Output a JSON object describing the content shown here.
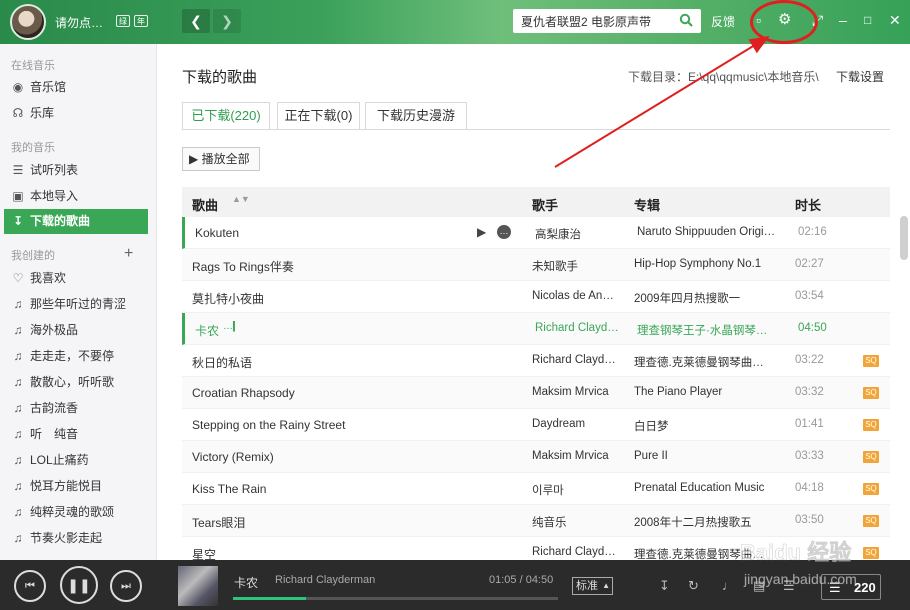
{
  "header": {
    "user_name": "请勿点…",
    "badge1": "绿",
    "badge2": "年",
    "search_placeholder": "夏仇者联盟2 电影原声带",
    "search_value": "夏仇者联盟2 电影原声带",
    "feedback_label": "反馈",
    "icons": [
      "back-arrow-icon",
      "forward-arrow-icon",
      "search-icon",
      "shirt-icon",
      "gear-icon",
      "resize-icon",
      "minimize-icon",
      "maximize-icon",
      "close-icon"
    ]
  },
  "sidebar": {
    "sections": [
      {
        "title": "在线音乐"
      },
      {
        "title": "我的音乐"
      },
      {
        "title": "我创建的"
      }
    ],
    "online": [
      {
        "label": "音乐馆",
        "icon": "music-hall-icon"
      },
      {
        "label": "乐库",
        "icon": "headphones-icon"
      }
    ],
    "mine": [
      {
        "label": "试听列表",
        "icon": "list-icon"
      },
      {
        "label": "本地导入",
        "icon": "monitor-icon"
      },
      {
        "label": "下载的歌曲",
        "icon": "download-icon"
      }
    ],
    "created": [
      {
        "label": "我喜欢",
        "icon": "heart-icon"
      },
      {
        "label": "那些年听过的青涩",
        "icon": "music-note-icon"
      },
      {
        "label": "海外极品",
        "icon": "music-note-icon"
      },
      {
        "label": "走走走，不要停",
        "icon": "music-note-icon"
      },
      {
        "label": "散散心，听听歌",
        "icon": "music-note-icon"
      },
      {
        "label": "古韵流香",
        "icon": "music-note-icon"
      },
      {
        "label": "听　纯音",
        "icon": "music-note-icon"
      },
      {
        "label": "LOL止痛药",
        "icon": "music-note-icon"
      },
      {
        "label": "悦耳方能悦目",
        "icon": "music-note-icon"
      },
      {
        "label": "纯粹灵魂的歌颂",
        "icon": "music-note-icon"
      },
      {
        "label": "节奏火影走起",
        "icon": "music-note-icon"
      }
    ]
  },
  "main": {
    "title": "下载的歌曲",
    "download_dir": "下载目录：E:\\qq\\qqmusic\\本地音乐\\",
    "download_settings": "下载设置",
    "tabs": [
      {
        "label": "已下载(220)"
      },
      {
        "label": "正在下载(0)"
      },
      {
        "label": "下载历史漫游"
      }
    ],
    "play_all": "▶ 播放全部",
    "columns": {
      "title": "歌曲",
      "artist": "歌手",
      "album": "专辑",
      "duration": "时长"
    },
    "rows": [
      {
        "title": "Kokuten",
        "artist": "高梨康治",
        "album": "Naruto Shippuuden Origin…",
        "duration": "02:16",
        "sq": ""
      },
      {
        "title": "Rags To Rings伴奏",
        "artist": "未知歌手",
        "album": "Hip-Hop Symphony No.1",
        "duration": "02:27",
        "sq": ""
      },
      {
        "title": "莫扎特小夜曲",
        "artist": "Nicolas de Ang…",
        "album": "2009年四月热搜歌一",
        "duration": "03:54",
        "sq": ""
      },
      {
        "title": "卡农",
        "artist": "Richard Clayd…",
        "album": "理查钢琴王子·水晶钢琴…",
        "duration": "04:50",
        "sq": ""
      },
      {
        "title": "秋日的私语",
        "artist": "Richard Clayd…",
        "album": "理查德.克莱德曼钢琴曲…",
        "duration": "03:22",
        "sq": "SQ"
      },
      {
        "title": "Croatian Rhapsody",
        "artist": "Maksim Mrvica",
        "album": "The Piano Player",
        "duration": "03:32",
        "sq": "SQ"
      },
      {
        "title": "Stepping on the Rainy Street",
        "artist": "Daydream",
        "album": "白日梦",
        "duration": "01:41",
        "sq": "SQ"
      },
      {
        "title": "Victory (Remix)",
        "artist": "Maksim Mrvica",
        "album": "Pure II",
        "duration": "03:33",
        "sq": "SQ"
      },
      {
        "title": "Kiss The Rain",
        "artist": "이루마",
        "album": "Prenatal Education Music",
        "duration": "04:18",
        "sq": "SQ"
      },
      {
        "title": "Tears眼泪",
        "artist": "纯音乐",
        "album": "2008年十二月热搜歌五",
        "duration": "03:50",
        "sq": "SQ"
      },
      {
        "title": "星空",
        "artist": "Richard Clayd…",
        "album": "理查德.克莱德曼钢琴曲…",
        "duration": "",
        "sq": "SQ"
      }
    ]
  },
  "player": {
    "now_playing_title": "卡农",
    "now_playing_artist": "Richard Clayderman",
    "time": "01:05 / 04:50",
    "progress": 0.224,
    "quality": "标准",
    "playlist_count": "220"
  },
  "watermark": "Baidu经验 jingyan.baidu.com"
}
